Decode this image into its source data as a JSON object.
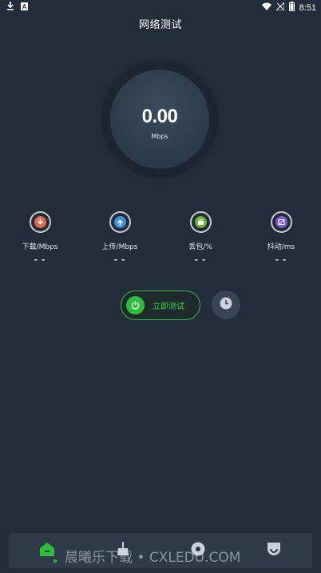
{
  "status_bar": {
    "time": "8:51",
    "left_icons": [
      "download-icon",
      "text-a-icon"
    ],
    "right_icons": [
      "wifi-icon",
      "no-signal-icon",
      "battery-icon"
    ]
  },
  "header": {
    "title": "网络测试"
  },
  "gauge": {
    "value": "0.00",
    "unit": "Mbps"
  },
  "metrics": [
    {
      "label": "下载/Mbps",
      "value": "- -",
      "icon": "download-arrow-icon",
      "color": "#e2684a"
    },
    {
      "label": "上传/Mbps",
      "value": "- -",
      "icon": "upload-arrow-icon",
      "color": "#3d8fe0"
    },
    {
      "label": "丢包/%",
      "value": "- -",
      "icon": "bag-icon",
      "color": "#6fb33a"
    },
    {
      "label": "抖动/ms",
      "value": "- -",
      "icon": "jitter-icon",
      "color": "#7d5ad6"
    }
  ],
  "actions": {
    "start_label": "立即测试",
    "start_icon": "power-icon",
    "history_icon": "clock-icon"
  },
  "bottom_nav": {
    "items": [
      "home-icon",
      "broom-icon",
      "compass-icon",
      "shield-icon"
    ],
    "active_color": "#2dbe3c"
  },
  "watermark": "晨曦乐下载 • CXLEDU.COM"
}
